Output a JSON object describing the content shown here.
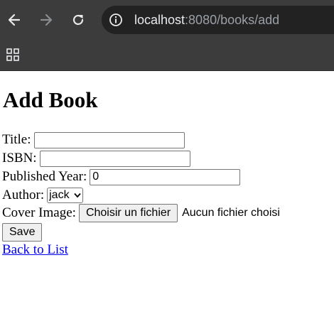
{
  "browser": {
    "url_host": "localhost",
    "url_rest": ":8080/books/add",
    "icons": {
      "back": "arrow-left-icon",
      "forward": "arrow-right-icon",
      "reload": "reload-icon",
      "site_info": "info-icon",
      "apps": "apps-grid-icon"
    }
  },
  "page": {
    "heading": "Add Book",
    "form": {
      "title_label": "Title:",
      "title_value": "",
      "isbn_label": "ISBN:",
      "isbn_value": "",
      "year_label": "Published Year:",
      "year_value": "0",
      "author_label": "Author:",
      "author_selected": "jack",
      "cover_label": "Cover Image:",
      "file_button": "Choisir un fichier",
      "file_status": "Aucun fichier choisi",
      "save_label": "Save"
    },
    "back_link": "Back to List",
    "link_color": "#0000ee"
  }
}
